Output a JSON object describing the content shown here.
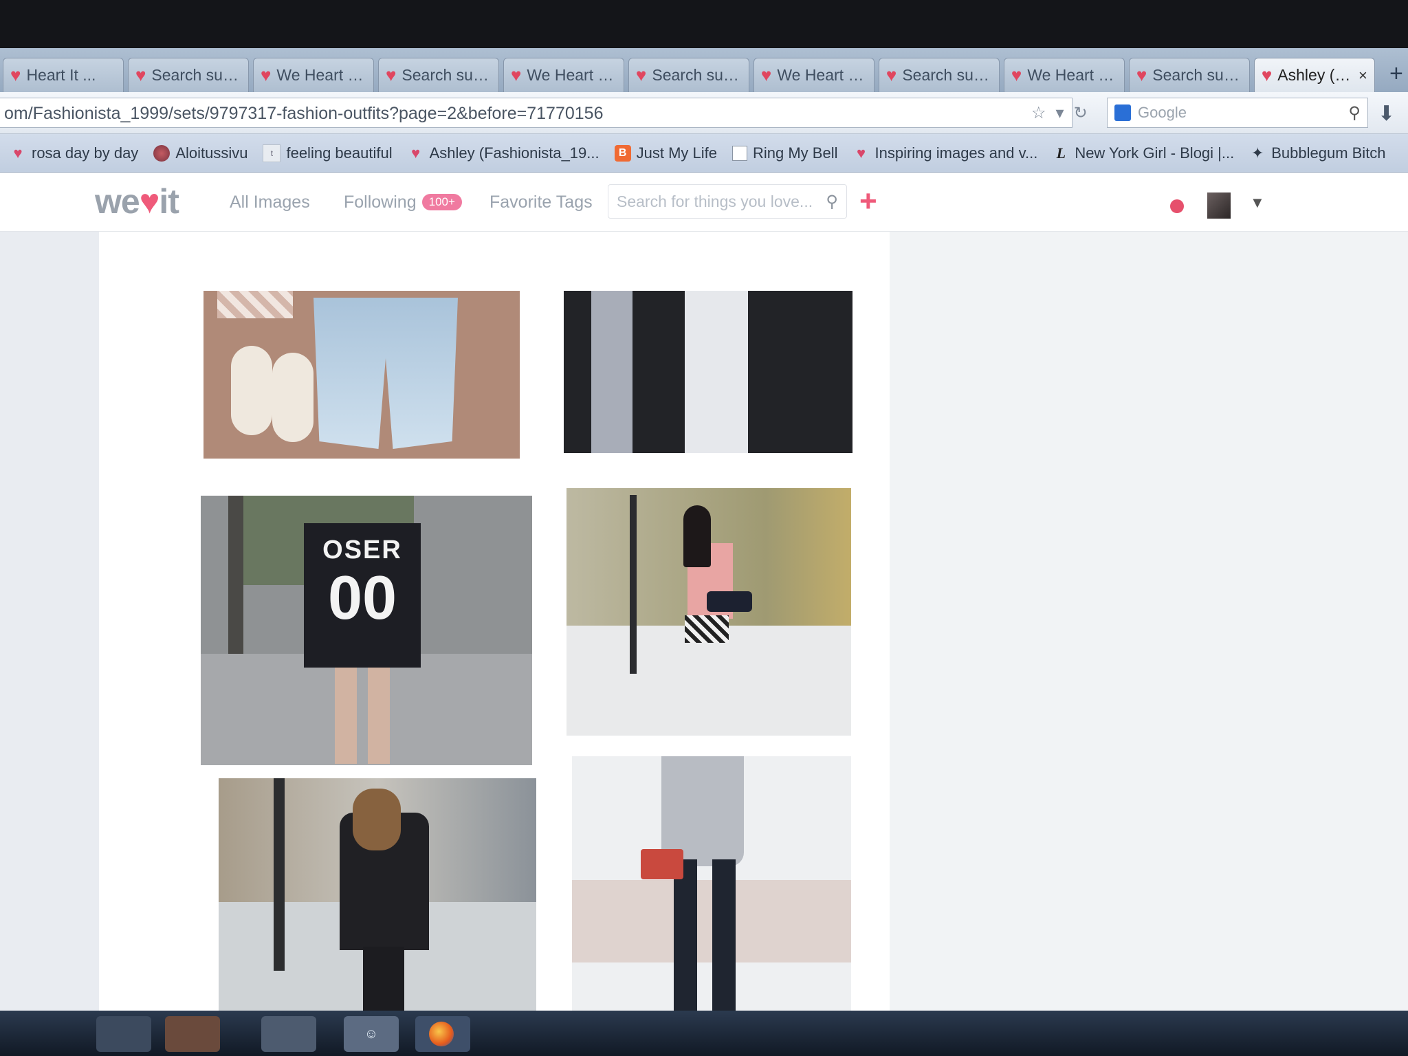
{
  "browser": {
    "tabs": [
      {
        "label": "Heart It ...",
        "icon": "heart-icon"
      },
      {
        "label": "Search sum...",
        "icon": "heart-icon"
      },
      {
        "label": "We Heart It ...",
        "icon": "heart-icon"
      },
      {
        "label": "Search sum...",
        "icon": "heart-icon"
      },
      {
        "label": "We Heart It ...",
        "icon": "heart-icon"
      },
      {
        "label": "Search sum...",
        "icon": "heart-icon"
      },
      {
        "label": "We Heart It ...",
        "icon": "heart-icon"
      },
      {
        "label": "Search sum...",
        "icon": "heart-icon"
      },
      {
        "label": "We Heart It ...",
        "icon": "heart-icon"
      },
      {
        "label": "Search sum...",
        "icon": "heart-icon"
      },
      {
        "label": "Ashley (F...",
        "icon": "heart-icon",
        "active": true
      }
    ],
    "tab_close": "×",
    "new_tab": "+",
    "url": "om/Fashionista_1999/sets/9797317-fashion-outfits?page=2&before=71770156",
    "search_placeholder": "Google",
    "bookmarks": [
      {
        "label": "rosa day by day",
        "icon": "heart-icon"
      },
      {
        "label": "Aloitussivu",
        "icon": "avatar-icon"
      },
      {
        "label": "feeling beautiful",
        "icon": "tumblr-icon"
      },
      {
        "label": "Ashley (Fashionista_19...",
        "icon": "heart-icon"
      },
      {
        "label": "Just My Life",
        "icon": "blogger-icon"
      },
      {
        "label": "Ring My Bell",
        "icon": "blank-page-icon"
      },
      {
        "label": "Inspiring images and v...",
        "icon": "heart-icon"
      },
      {
        "label": "New York Girl - Blogi |...",
        "icon": "l-icon"
      },
      {
        "label": "Bubblegum Bitch",
        "icon": "star-icon"
      }
    ]
  },
  "site": {
    "logo": {
      "left": "we",
      "heart": "♥",
      "right": "it"
    },
    "nav": {
      "all_images": "All Images",
      "following": "Following",
      "following_badge": "100+",
      "favorite_tags": "Favorite Tags"
    },
    "search_placeholder": "Search for things you love...",
    "add": "+"
  },
  "photos": {
    "jersey_word": "OSER",
    "jersey_number": "00"
  },
  "colors": {
    "accent": "#ef5a7a",
    "badge": "#f07aa0"
  }
}
